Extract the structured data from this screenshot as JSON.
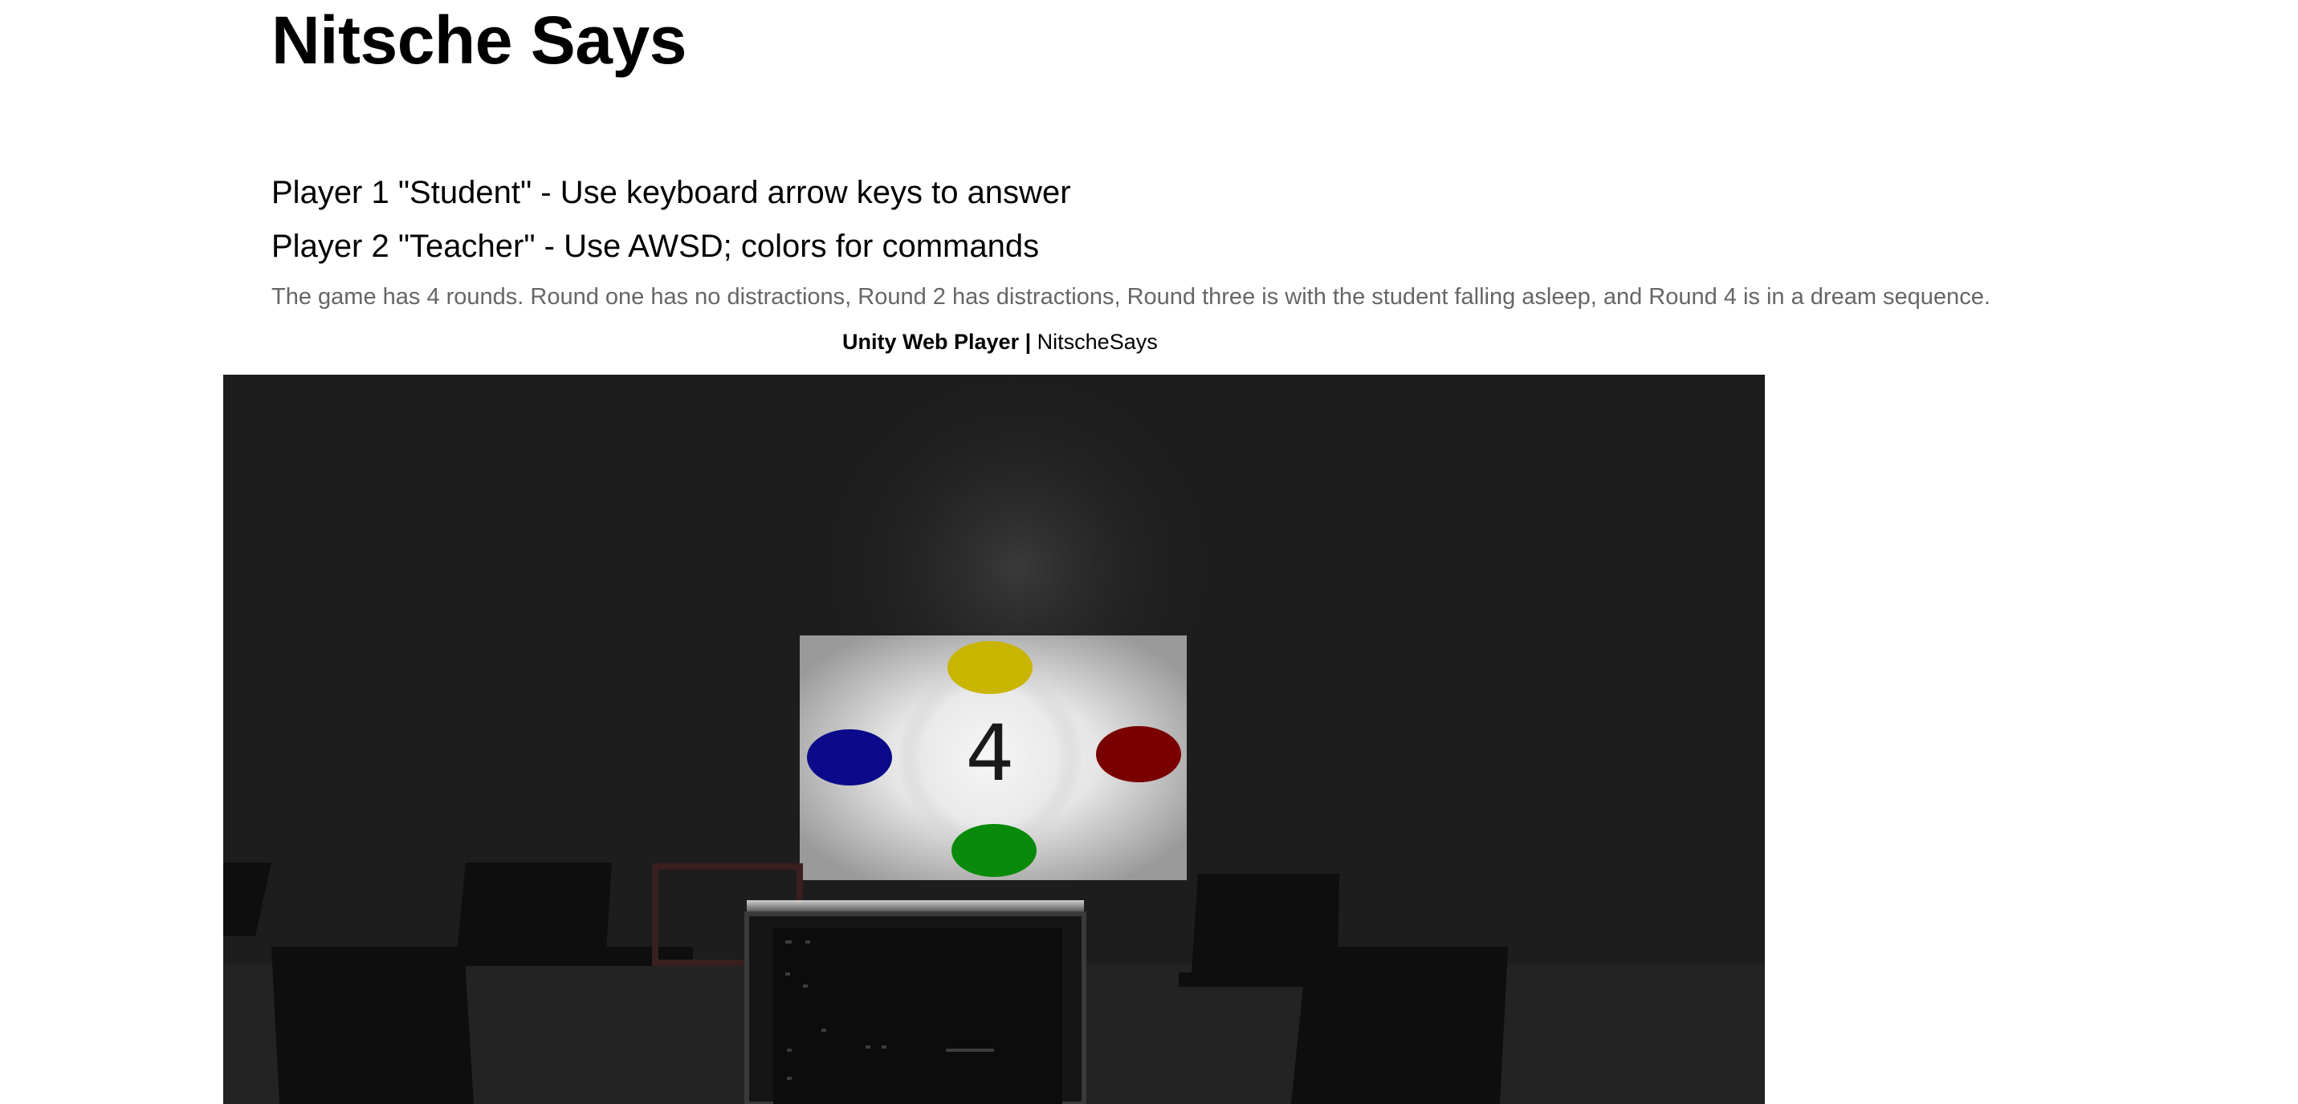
{
  "page": {
    "title": "Nitsche Says",
    "player1_instructions": "Player 1 \"Student\" - Use keyboard arrow keys to answer",
    "player2_instructions": "Player 2 \"Teacher\" - Use AWSD; colors for commands",
    "description": "The game has 4 rounds. Round one has no distractions, Round 2 has distractions, Round three is with the student falling asleep, and Round 4 is in a dream sequence."
  },
  "unity": {
    "player_name": "Unity Web Player",
    "separator": "|",
    "game_name": "NitscheSays"
  },
  "game": {
    "board_number": "4",
    "colors": {
      "top": "#c9b400",
      "left": "#0a0a8a",
      "right": "#7a0000",
      "bottom": "#0a8a0a"
    }
  }
}
